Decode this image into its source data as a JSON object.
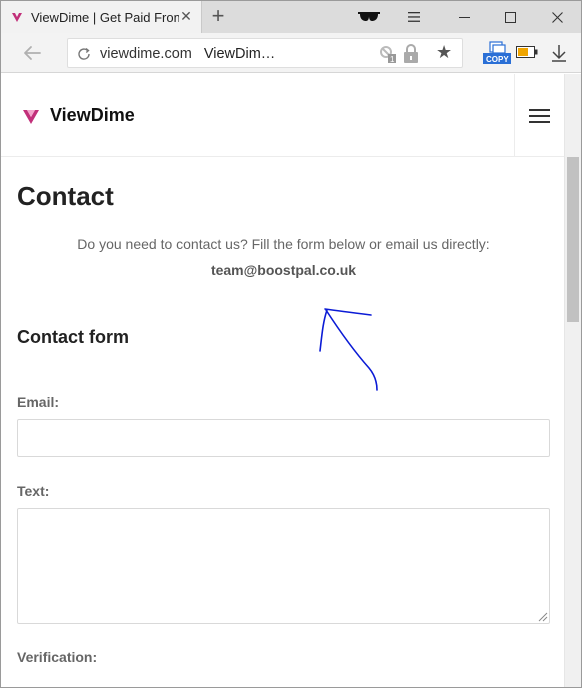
{
  "browser": {
    "tab": {
      "title": "ViewDime | Get Paid From",
      "close_glyph": "✕"
    },
    "new_tab_glyph": "+",
    "address": {
      "domain": "viewdime.com",
      "page_title": "ViewDim…"
    },
    "copy_extension_label": "COPY",
    "colors": {
      "copy_extension": "#2a6fd6",
      "battery_fill": "#f0a500"
    },
    "icons": [
      "favicon-icon",
      "close-icon",
      "plus-icon",
      "incognito-glasses-icon",
      "menu-icon",
      "minimize-icon",
      "maximize-icon",
      "window-close-icon",
      "back-arrow-icon",
      "reload-icon",
      "blocked-popup-icon",
      "lock-icon",
      "star-icon",
      "copy-extension-icon",
      "battery-icon",
      "download-icon"
    ]
  },
  "site": {
    "brand": "ViewDime",
    "brand_color": "#c2307a"
  },
  "page": {
    "title": "Contact",
    "intro": "Do you need to contact us? Fill the form below or email us directly:",
    "email": "team@boostpal.co.uk",
    "form_heading": "Contact form",
    "fields": {
      "email_label": "Email:",
      "email_value": "",
      "text_label": "Text:",
      "text_value": "",
      "verification_label": "Verification:"
    }
  },
  "annotation": {
    "color": "#0b1bd6",
    "shape": "hand-drawn arrow"
  }
}
